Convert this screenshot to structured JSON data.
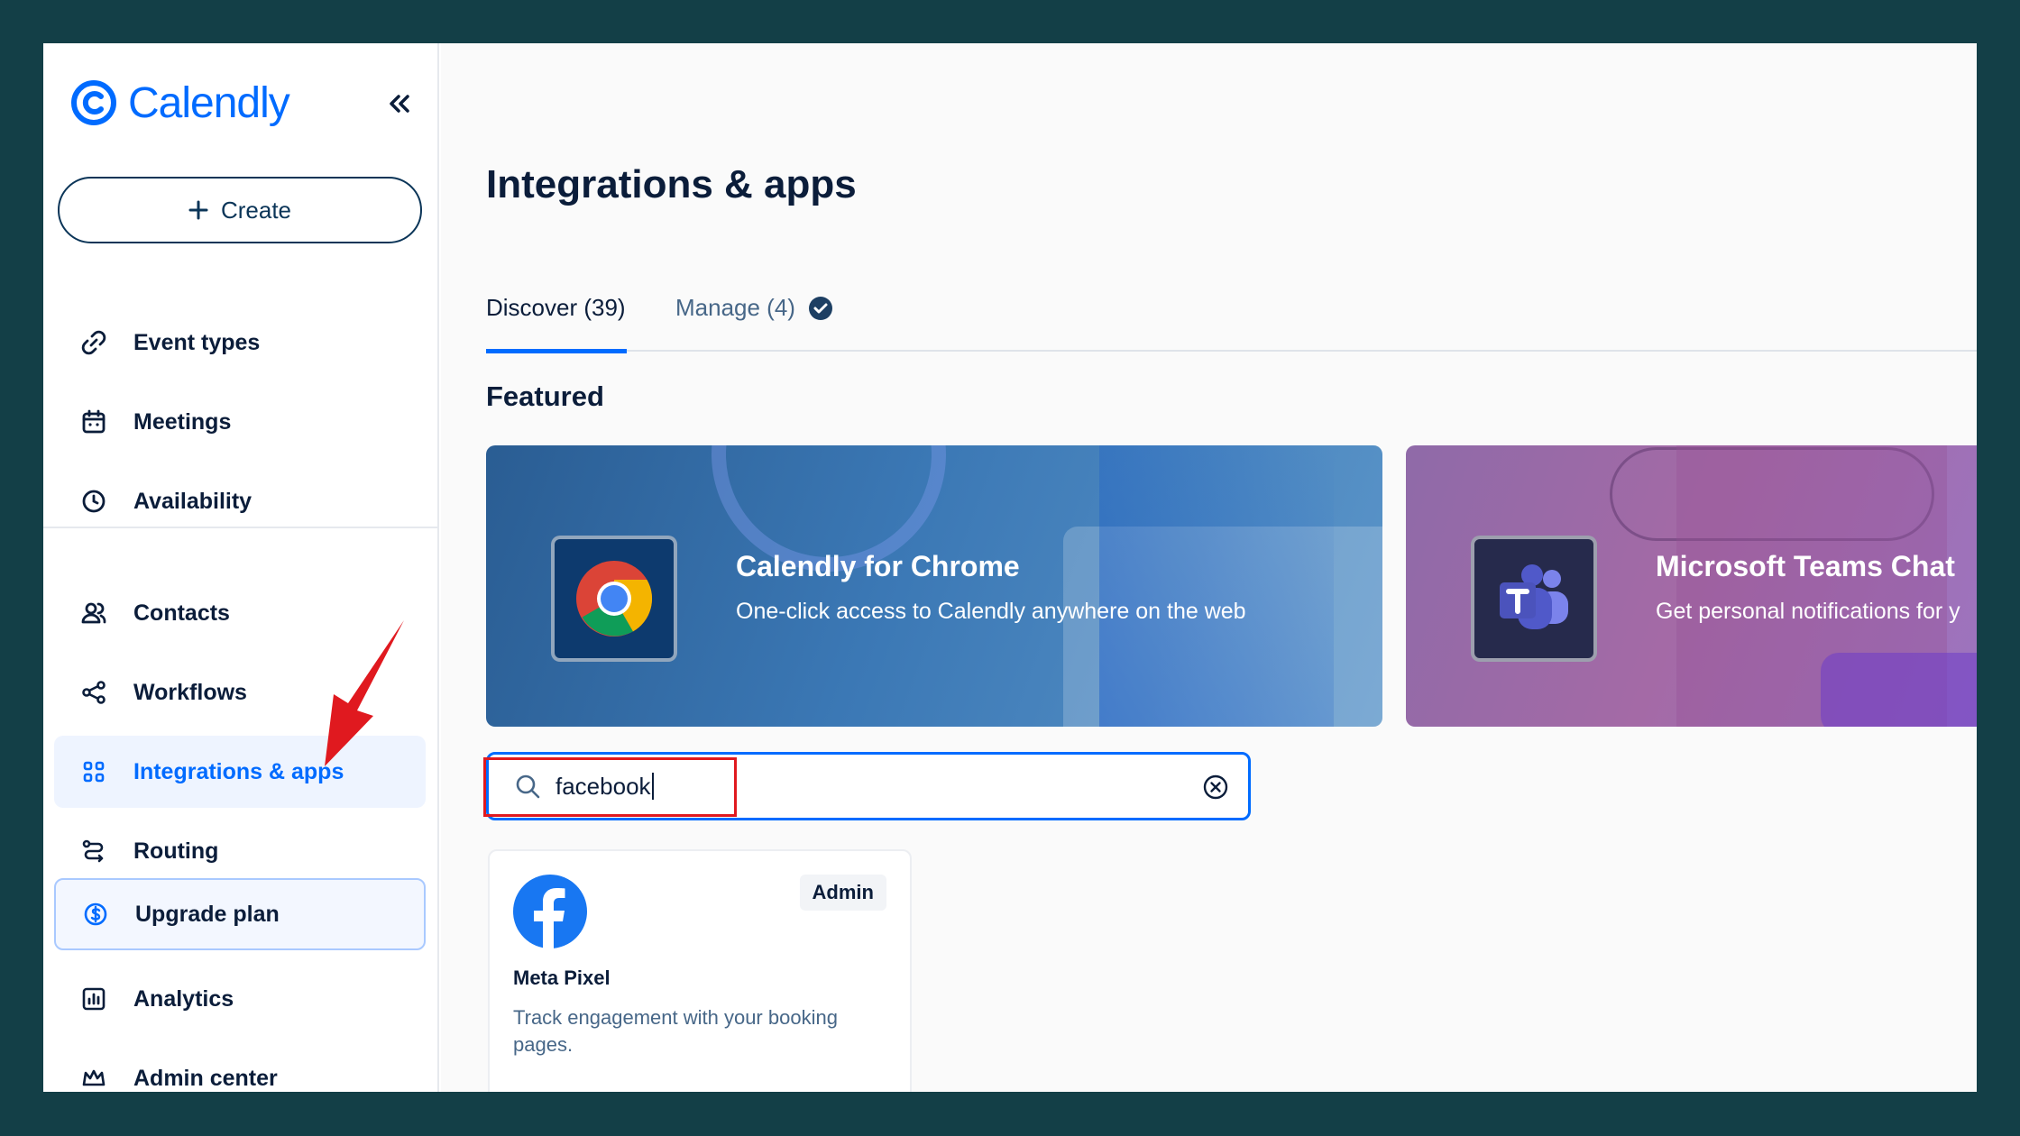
{
  "app": {
    "logo_text": "Calendly"
  },
  "sidebar": {
    "create_label": "Create",
    "items": [
      {
        "label": "Event types",
        "icon": "link-icon"
      },
      {
        "label": "Meetings",
        "icon": "calendar-icon"
      },
      {
        "label": "Availability",
        "icon": "clock-icon"
      },
      {
        "label": "Contacts",
        "icon": "people-icon"
      },
      {
        "label": "Workflows",
        "icon": "workflow-icon"
      },
      {
        "label": "Integrations & apps",
        "icon": "grid-icon",
        "active": true
      },
      {
        "label": "Routing",
        "icon": "routing-icon"
      },
      {
        "label": "Upgrade plan",
        "icon": "dollar-icon"
      },
      {
        "label": "Analytics",
        "icon": "analytics-icon"
      },
      {
        "label": "Admin center",
        "icon": "crown-icon"
      }
    ]
  },
  "main": {
    "title": "Integrations & apps",
    "tabs": [
      {
        "label": "Discover (39)",
        "active": true
      },
      {
        "label": "Manage (4)",
        "icon": "check-circle-icon"
      }
    ],
    "featured_title": "Featured",
    "featured": [
      {
        "title": "Calendly for Chrome",
        "subtitle": "One-click access to Calendly anywhere on the web",
        "icon": "chrome-icon"
      },
      {
        "title": "Microsoft Teams Chat",
        "subtitle": "Get personal notifications for y",
        "icon": "teams-icon"
      }
    ],
    "search": {
      "value": "facebook"
    },
    "results": [
      {
        "name": "Meta Pixel",
        "badge": "Admin",
        "description": "Track engagement with your booking pages.",
        "icon": "facebook-icon"
      }
    ]
  },
  "colors": {
    "accent": "#006bff",
    "frame": "#133f47",
    "annotation": "#e0191f"
  }
}
